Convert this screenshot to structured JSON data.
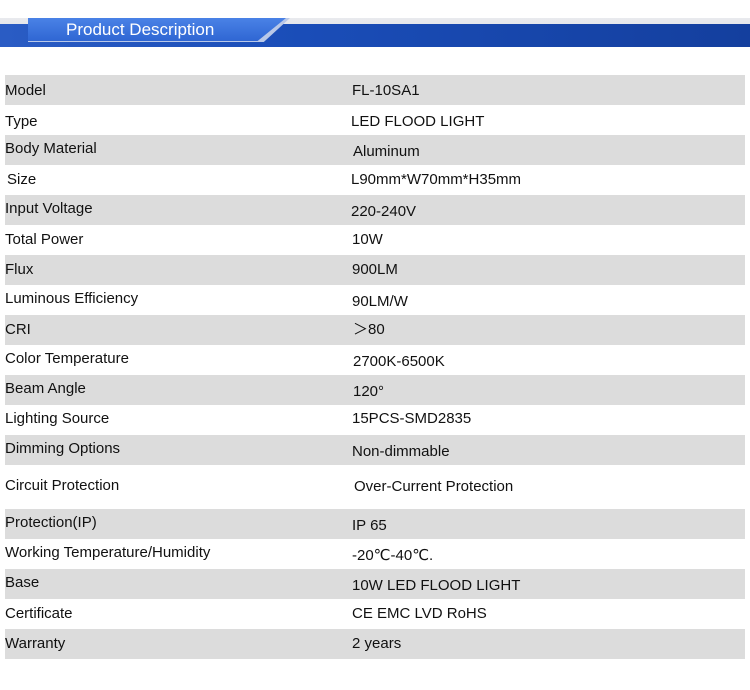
{
  "header": {
    "title": "Product Description"
  },
  "specs": [
    {
      "label": "Model",
      "value": "FL-10SA1"
    },
    {
      "label": "Type",
      "value": "LED FLOOD LIGHT"
    },
    {
      "label": "Body Material",
      "value": "Aluminum"
    },
    {
      "label": "Size",
      "value": "L90mm*W70mm*H35mm"
    },
    {
      "label": "Input Voltage",
      "value": "220-240V"
    },
    {
      "label": "Total Power",
      "value": "10W"
    },
    {
      "label": "Flux",
      "value": "900LM"
    },
    {
      "label": "Luminous Efficiency",
      "value": "90LM/W"
    },
    {
      "label": "CRI",
      "value": "＞80"
    },
    {
      "label": "Color Temperature",
      "value": "2700K-6500K"
    },
    {
      "label": "Beam Angle",
      "value": "120°"
    },
    {
      "label": "Lighting Source",
      "value": "15PCS-SMD2835"
    },
    {
      "label": "Dimming Options",
      "value": "Non-dimmable"
    },
    {
      "label": "Circuit Protection",
      "value": "Over-Current Protection"
    },
    {
      "label": "Protection(IP)",
      "value": "IP 65"
    },
    {
      "label": "Working Temperature/Humidity",
      "value": "-20℃-40℃."
    },
    {
      "label": "Base",
      "value": "10W LED FLOOD LIGHT"
    },
    {
      "label": "Certificate",
      "value": "CE EMC LVD RoHS"
    },
    {
      "label": "Warranty",
      "value": "2 years"
    }
  ]
}
